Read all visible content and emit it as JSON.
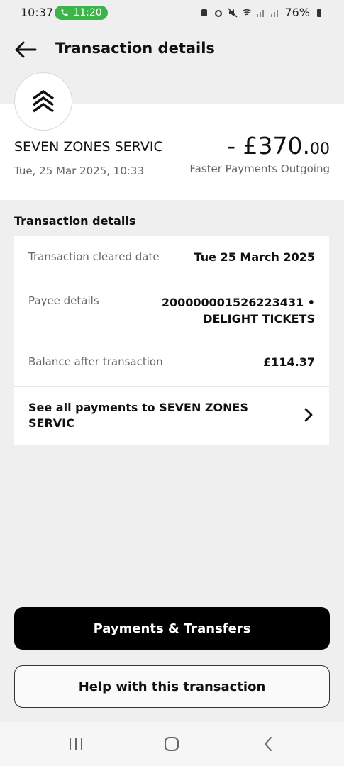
{
  "status_bar": {
    "time": "10:37",
    "call_timer": "11:20",
    "battery": "76%",
    "icons": [
      "phone-icon",
      "alarm-icon",
      "mute-icon",
      "wifi-icon",
      "signal-icon",
      "battery-icon"
    ]
  },
  "header": {
    "title": "Transaction details",
    "back_icon": "arrow-left-icon"
  },
  "summary": {
    "logo_icon": "chevron-stack-icon",
    "merchant": "SEVEN ZONES SERVIC",
    "date": "Tue, 25 Mar 2025, 10:33",
    "amount_main": "- £370.",
    "amount_pence": "00",
    "type": "Faster Payments Outgoing"
  },
  "details": {
    "section_title": "Transaction details",
    "rows": [
      {
        "label": "Transaction cleared date",
        "value": "Tue 25 March 2025"
      },
      {
        "label": "Payee details",
        "value_line1": "200000001526223431 •",
        "value_line2": "DELIGHT TICKETS"
      },
      {
        "label": "Balance after transaction",
        "value": "£114.37"
      }
    ],
    "see_all": "See all payments to SEVEN ZONES SERVIC"
  },
  "buttons": {
    "primary": "Payments & Transfers",
    "secondary": "Help with this transaction"
  },
  "nav": {
    "icons": [
      "recent-apps-icon",
      "home-icon",
      "back-icon"
    ]
  },
  "colors": {
    "background": "#efefef",
    "card": "#ffffff",
    "primary_button": "#000000",
    "call_pill": "#3bb54a",
    "muted_text": "#666666"
  }
}
